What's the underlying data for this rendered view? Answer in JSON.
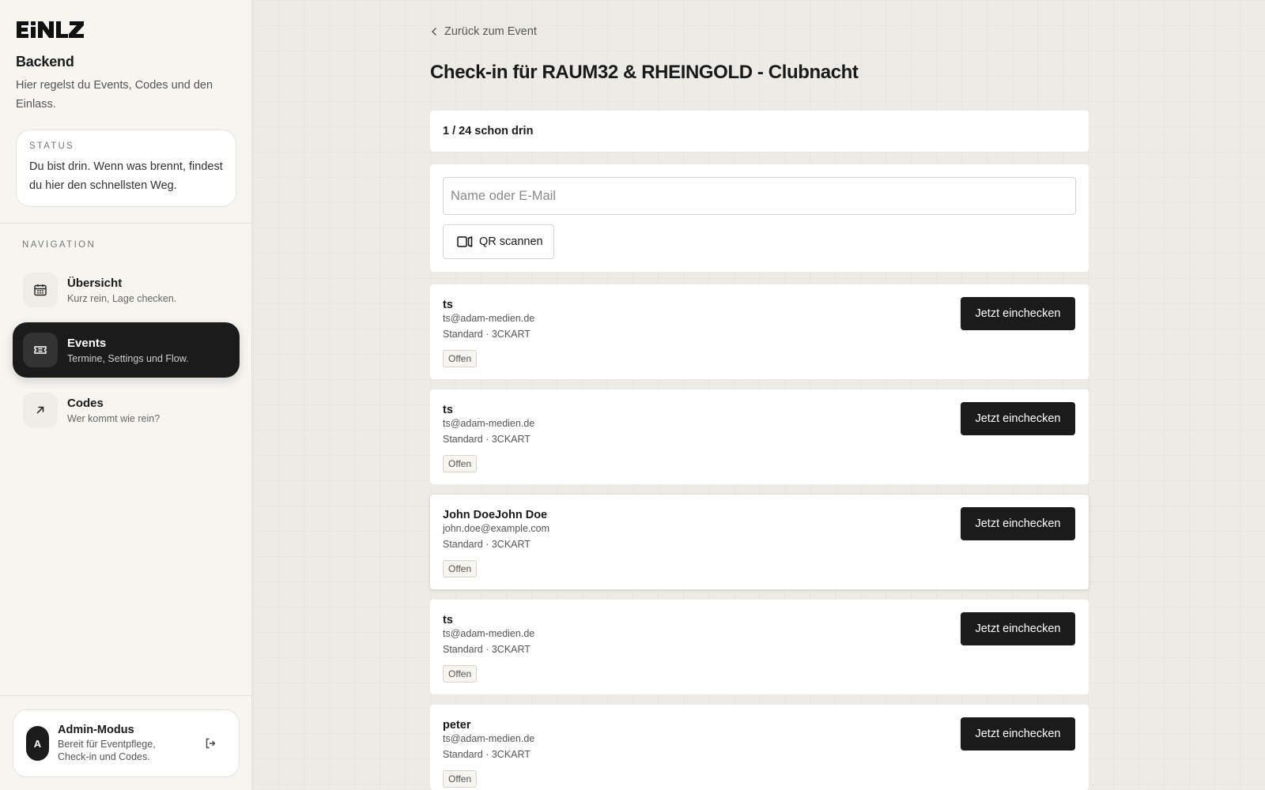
{
  "sidebar": {
    "logo_text": "EINLZ",
    "brand_title": "Backend",
    "brand_desc": "Hier regelst du Events, Codes und den Einlass.",
    "status": {
      "label": "STATUS",
      "text": "Du bist drin. Wenn was brennt, findest du hier den schnellsten Weg."
    },
    "nav_label": "NAVIGATION",
    "items": [
      {
        "title": "Übersicht",
        "sub": "Kurz rein, Lage checken.",
        "icon": "calendar-icon",
        "active": false
      },
      {
        "title": "Events",
        "sub": "Termine, Settings und Flow.",
        "icon": "ticket-icon",
        "active": true
      },
      {
        "title": "Codes",
        "sub": "Wer kommt wie rein?",
        "icon": "arrow-up-right-icon",
        "active": false
      }
    ],
    "admin": {
      "avatar": "A",
      "title": "Admin-Modus",
      "sub": "Bereit für Eventpflege, Check-in und Codes.",
      "logout_icon": "logout-icon"
    }
  },
  "main": {
    "back_label": "Zurück zum Event",
    "title": "Check-in für RAUM32 & RHEINGOLD - Clubnacht",
    "count_text": "1 / 24 schon drin",
    "search": {
      "placeholder": "Name oder E-Mail",
      "value": ""
    },
    "qr_label": "QR scannen",
    "guests": [
      {
        "name": "ts",
        "email": "ts@adam-medien.de",
        "meta": "Standard · 3CKART",
        "status": "Offen",
        "action": "Jetzt einchecken"
      },
      {
        "name": "ts",
        "email": "ts@adam-medien.de",
        "meta": "Standard · 3CKART",
        "status": "Offen",
        "action": "Jetzt einchecken"
      },
      {
        "name": "John DoeJohn Doe",
        "email": "john.doe@example.com",
        "meta": "Standard · 3CKART",
        "status": "Offen",
        "action": "Jetzt einchecken"
      },
      {
        "name": "ts",
        "email": "ts@adam-medien.de",
        "meta": "Standard · 3CKART",
        "status": "Offen",
        "action": "Jetzt einchecken"
      },
      {
        "name": "peter",
        "email": "ts@adam-medien.de",
        "meta": "Standard · 3CKART",
        "status": "Offen",
        "action": "Jetzt einchecken"
      }
    ]
  },
  "colors": {
    "accent_dark": "#1b1b1b",
    "sidebar_bg": "#f6f5f0",
    "main_bg": "#ecebe5"
  }
}
